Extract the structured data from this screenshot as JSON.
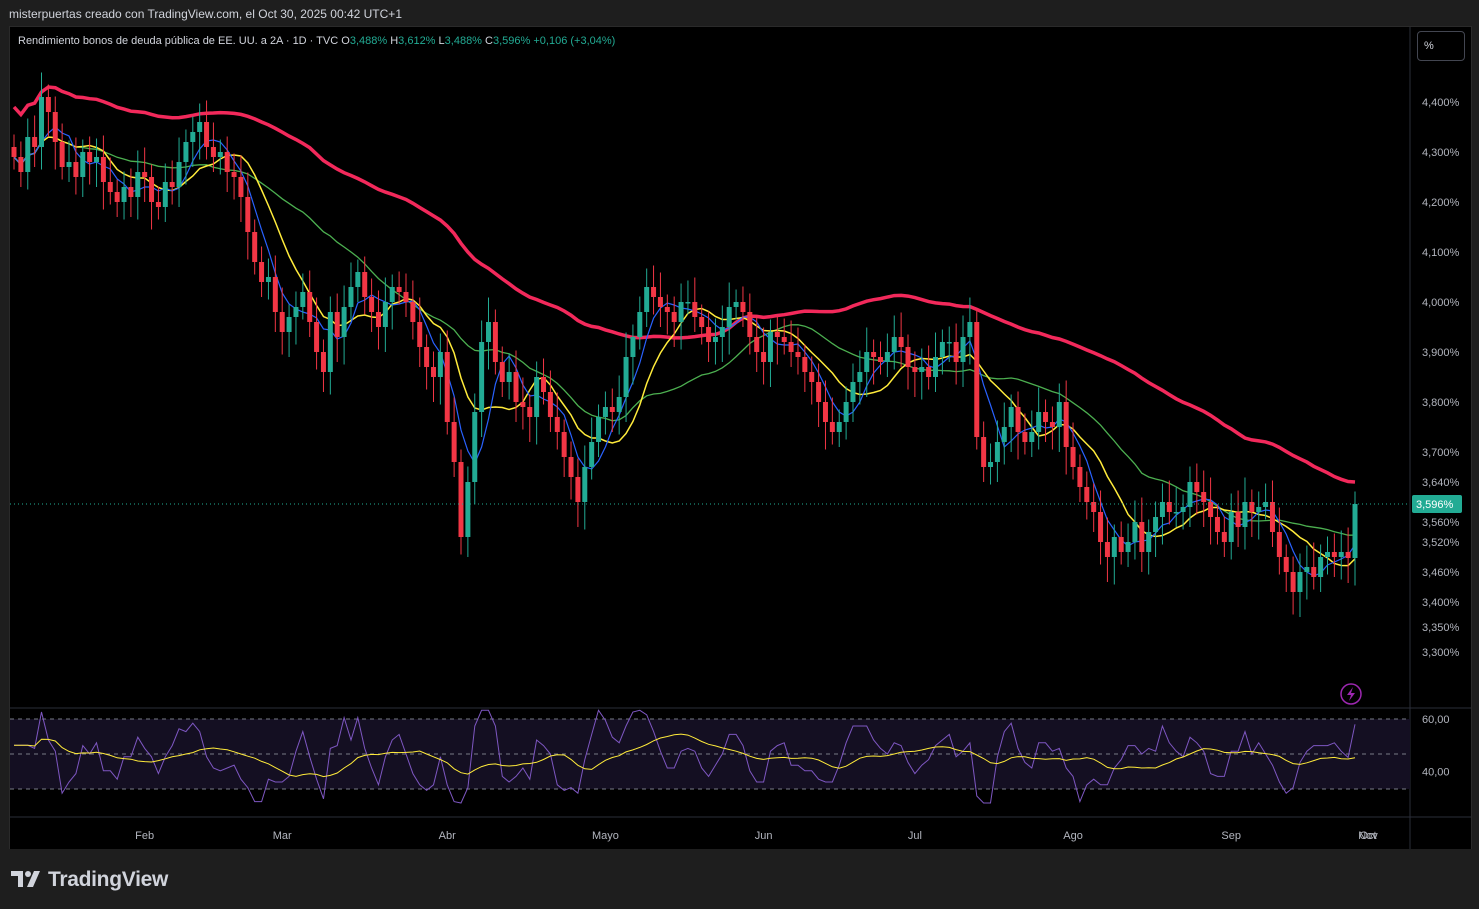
{
  "caption": "misterpuertas creado con TradingView.com, el Oct 30, 2025 00:42 UTC+1",
  "legend": {
    "title": "Rendimiento bonos de deuda pública de EE. UU. a 2A · 1D · TVC",
    "o_label": "O",
    "o_value": "3,488%",
    "h_label": "H",
    "h_value": "3,612%",
    "l_label": "L",
    "l_value": "3,488%",
    "c_label": "C",
    "c_value": "3,596%",
    "change": "+0,106 (+3,04%)"
  },
  "scale_button": "%",
  "brand": "TradingView",
  "colors": {
    "up": "#22ab94",
    "down": "#f23645",
    "ma_fast": "#2962ff",
    "ma_mid": "#ffeb3b",
    "ma_slow": "#4caf50",
    "ma_long": "#f2295b",
    "rsi": "#7e57c2",
    "rsi_ma": "#ffeb3b",
    "rsi_band": "#140f22",
    "last_price": "#22ab94"
  },
  "chart_data": {
    "type": "candlestick",
    "title": "Rendimiento bonos de deuda pública de EE. UU. a 2A · 1D · TVC",
    "y_unit": "%",
    "y_ticks": [
      "4,400%",
      "4,300%",
      "4,200%",
      "4,100%",
      "4,000%",
      "3,900%",
      "3,800%",
      "3,700%",
      "3,640%",
      "3,560%",
      "3,520%",
      "3,460%",
      "3,400%",
      "3,350%",
      "3,300%"
    ],
    "y_range": [
      3.3,
      4.5
    ],
    "x_ticks": [
      "Feb",
      "Mar",
      "Abr",
      "Mayo",
      "Jun",
      "Jul",
      "Ago",
      "Sep",
      "Oct",
      "Nov"
    ],
    "last_price_label": "3,596%",
    "last_price": 3.596,
    "candles_close": [
      4.29,
      4.26,
      4.33,
      4.31,
      4.41,
      4.38,
      4.32,
      4.27,
      4.28,
      4.25,
      4.3,
      4.28,
      4.29,
      4.24,
      4.22,
      4.2,
      4.23,
      4.21,
      4.26,
      4.25,
      4.2,
      4.19,
      4.24,
      4.23,
      4.28,
      4.32,
      4.34,
      4.36,
      4.31,
      4.29,
      4.3,
      4.26,
      4.25,
      4.21,
      4.14,
      4.08,
      4.04,
      4.05,
      3.98,
      3.94,
      3.97,
      3.99,
      4.02,
      3.96,
      3.9,
      3.86,
      3.98,
      3.93,
      3.99,
      4.03,
      4.06,
      4.01,
      3.98,
      3.95,
      4.0,
      4.03,
      4.02,
      4.0,
      3.96,
      3.91,
      3.87,
      3.85,
      3.9,
      3.76,
      3.68,
      3.53,
      3.64,
      3.78,
      3.92,
      3.96,
      3.88,
      3.84,
      3.86,
      3.8,
      3.79,
      3.77,
      3.85,
      3.82,
      3.77,
      3.74,
      3.69,
      3.65,
      3.6,
      3.67,
      3.72,
      3.77,
      3.79,
      3.78,
      3.81,
      3.89,
      3.93,
      3.98,
      4.03,
      4.01,
      3.99,
      3.98,
      3.96,
      4.0,
      4.0,
      3.97,
      3.95,
      3.92,
      3.93,
      3.95,
      3.99,
      4.0,
      3.98,
      3.93,
      3.9,
      3.88,
      3.94,
      3.93,
      3.92,
      3.9,
      3.89,
      3.86,
      3.84,
      3.8,
      3.76,
      3.74,
      3.76,
      3.8,
      3.84,
      3.86,
      3.9,
      3.89,
      3.88,
      3.9,
      3.93,
      3.91,
      3.87,
      3.86,
      3.87,
      3.85,
      3.89,
      3.92,
      3.92,
      3.88,
      3.93,
      3.96,
      3.73,
      3.67,
      3.68,
      3.72,
      3.75,
      3.79,
      3.74,
      3.72,
      3.74,
      3.78,
      3.76,
      3.75,
      3.8,
      3.71,
      3.67,
      3.63,
      3.6,
      3.58,
      3.52,
      3.49,
      3.53,
      3.5,
      3.52,
      3.56,
      3.5,
      3.54,
      3.57,
      3.6,
      3.58,
      3.58,
      3.59,
      3.64,
      3.62,
      3.6,
      3.57,
      3.54,
      3.52,
      3.58,
      3.55,
      3.6,
      3.58,
      3.59,
      3.6,
      3.54,
      3.49,
      3.46,
      3.42,
      3.46,
      3.47,
      3.45,
      3.49,
      3.5,
      3.49,
      3.5,
      3.488,
      3.596
    ],
    "overlays": [
      "SMA fast (blue)",
      "SMA 20 (yellow)",
      "SMA 50 (green)",
      "SMA 200 (red)"
    ],
    "rsi_pane": {
      "tick_labels": [
        "60,00",
        "40,00"
      ],
      "band_levels": [
        70,
        50,
        30
      ],
      "range": [
        20,
        80
      ]
    }
  }
}
